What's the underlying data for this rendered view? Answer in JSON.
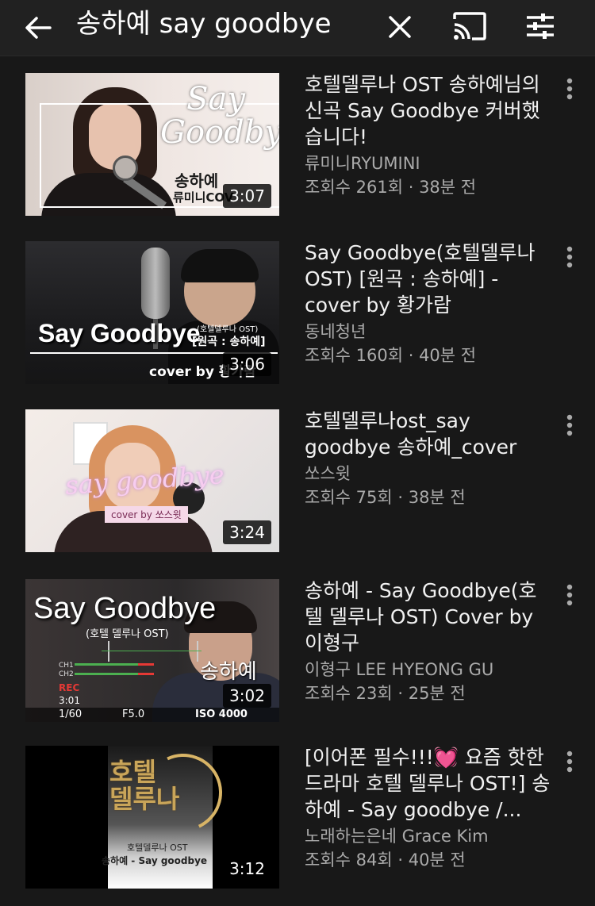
{
  "colors": {
    "background": "#181818",
    "topbar": "#212121",
    "text_primary": "#f1f1f1",
    "text_secondary": "#aaaaaa"
  },
  "header": {
    "back_icon": "arrow-left-icon",
    "query": "송하예 say goodbye",
    "clear_icon": "close-icon",
    "cast_icon": "cast-icon",
    "filter_icon": "filter-sliders-icon"
  },
  "results": [
    {
      "title": "호텔델루나 OST 송하예님의 신곡 Say Goodbye 커버했습니다!",
      "channel": "류미니RYUMINI",
      "stats": "조회수 261회 · 38분 전",
      "duration": "3:07",
      "thumb": {
        "line1": "Say",
        "line2": "Goodbye",
        "name": "송하예",
        "sub": "류미니COV"
      }
    },
    {
      "title": "Say Goodbye(호텔델루나 OST) [원곡 : 송하예] - cover by 황가람",
      "channel": "동네청년",
      "stats": "조회수 160회 · 40분 전",
      "duration": "3:06",
      "thumb": {
        "say": "Say Goodbye",
        "small1": "(호텔델루나 OST)",
        "small2": "[원곡 : 송하예]",
        "cover": "cover by 황가람"
      }
    },
    {
      "title": "호텔델루나ost_say goodbye 송하예_cover",
      "channel": "쏘스윗",
      "stats": "조회수 75회 · 38분 전",
      "duration": "3:24",
      "thumb": {
        "say": "say goodbye",
        "tag": "cover by 쏘스윗"
      }
    },
    {
      "title": "송하예 - Say Goodbye(호텔 델루나 OST) Cover by 이형구",
      "channel": "이형구 LEE HYEONG GU",
      "stats": "조회수 23회 · 25분 전",
      "duration": "3:02",
      "thumb": {
        "say": "Say Goodbye",
        "small": "(호텔 델루나 OST)",
        "name": "송하예",
        "ch": "CH1\nCH2",
        "rec": "REC",
        "rectime": "3:01",
        "shutter": "1/60",
        "aperture": "F5.0",
        "iso": "ISO 4000"
      }
    },
    {
      "title": "[이어폰 필수!!!💓 요즘 핫한 드라마 호텔 델루나 OST!] 송하예 - Say goodbye /...",
      "channel": "노래하는은네 Grace Kim",
      "stats": "조회수 84회 · 40분 전",
      "duration": "3:12",
      "thumb": {
        "gold": "호텔\n델루나",
        "cap1": "호텔델루나 OST",
        "cap2": "송하예 - Say goodbye"
      }
    }
  ],
  "more_icon": "more-vert-icon"
}
